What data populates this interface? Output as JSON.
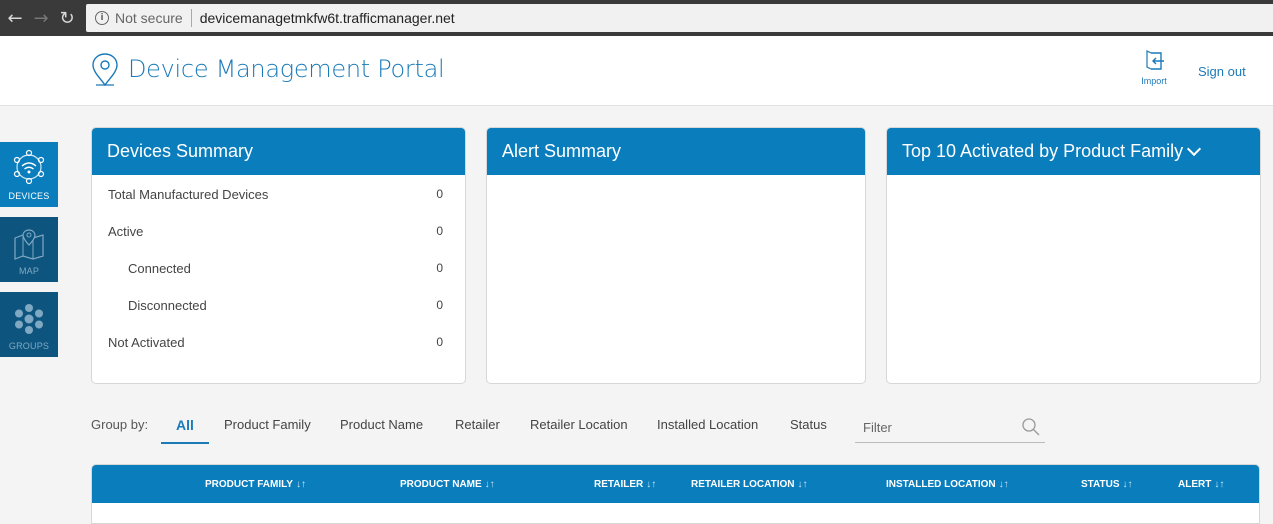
{
  "browser": {
    "security_label": "Not secure",
    "url": "devicemanagetmkfw6t.trafficmanager.net"
  },
  "header": {
    "title": "Device Management Portal",
    "import_label": "Import",
    "signout_label": "Sign out"
  },
  "sidenav": [
    {
      "label": "DEVICES",
      "icon": "wifi-devices-icon",
      "active": true
    },
    {
      "label": "MAP",
      "icon": "map-icon",
      "active": false
    },
    {
      "label": "GROUPS",
      "icon": "groups-icon",
      "active": false
    }
  ],
  "devices_summary": {
    "title": "Devices Summary",
    "rows": [
      {
        "label": "Total Manufactured Devices",
        "value": "0"
      },
      {
        "label": "Active",
        "value": "0"
      },
      {
        "label": "Connected",
        "value": "0"
      },
      {
        "label": "Disconnected",
        "value": "0"
      },
      {
        "label": "Not Activated",
        "value": "0"
      }
    ]
  },
  "alert_summary": {
    "title": "Alert Summary"
  },
  "top10": {
    "title": "Top 10 Activated by Product Family"
  },
  "groupby": {
    "label": "Group by:",
    "tabs": [
      "All",
      "Product Family",
      "Product Name",
      "Retailer",
      "Retailer Location",
      "Installed Location",
      "Status"
    ],
    "active": "All",
    "filter_placeholder": "Filter"
  },
  "table": {
    "columns": [
      "PRODUCT FAMILY",
      "PRODUCT NAME",
      "RETAILER",
      "RETAILER LOCATION",
      "INSTALLED LOCATION",
      "STATUS",
      "ALERT"
    ],
    "sort_glyph": "↓↑"
  },
  "colors": {
    "primary": "#0a7dbd",
    "primary_dark": "#0d557f",
    "link": "#1a7ab8"
  }
}
